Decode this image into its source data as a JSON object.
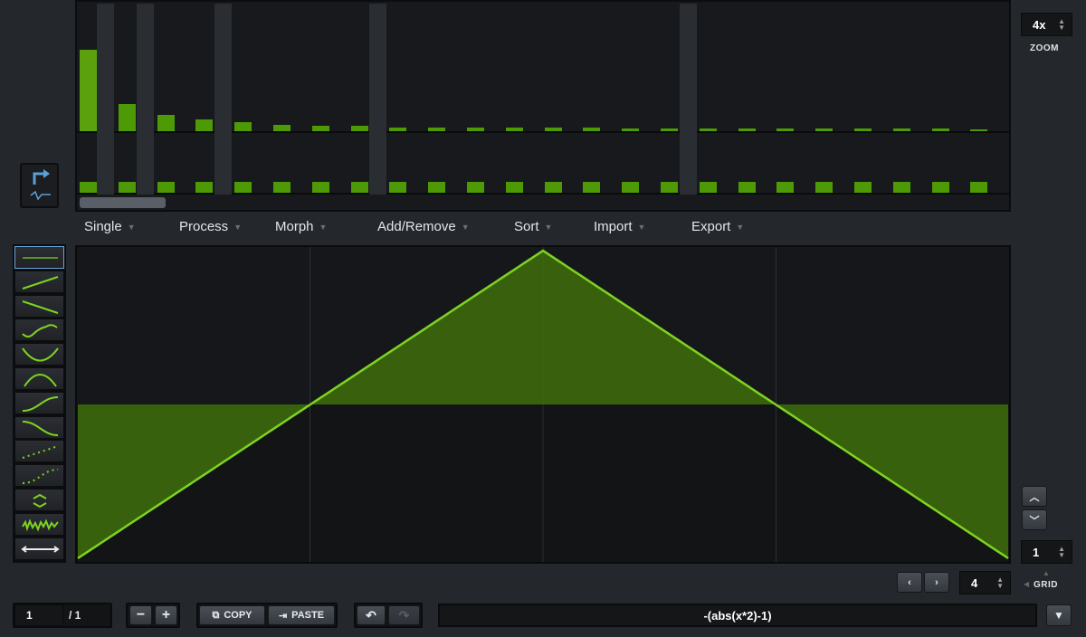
{
  "harmonics": {
    "amplitudes": [
      1.0,
      0.33,
      0.2,
      0.14,
      0.11,
      0.08,
      0.07,
      0.07,
      0.05,
      0.05,
      0.04,
      0.04,
      0.04,
      0.04,
      0.03,
      0.03,
      0.03,
      0.03,
      0.03,
      0.03,
      0.03,
      0.03,
      0.03,
      0.02
    ],
    "phases": [
      1,
      1,
      1,
      1,
      1,
      1,
      1,
      1,
      1,
      1,
      1,
      1,
      1,
      1,
      1,
      1,
      1,
      1,
      1,
      1,
      1,
      1,
      1,
      1
    ],
    "bar_color": "#4e9a06"
  },
  "zoom": {
    "value": "4x",
    "label": "ZOOM"
  },
  "menus": [
    {
      "label": "Single"
    },
    {
      "label": "Process"
    },
    {
      "label": "Morph"
    },
    {
      "label": "Add/Remove"
    },
    {
      "label": "Sort"
    },
    {
      "label": "Import"
    },
    {
      "label": "Export"
    }
  ],
  "shapes": [
    "flat-line",
    "ramp-up",
    "ramp-down",
    "sine",
    "bowl",
    "arch",
    "s-curve-up",
    "s-curve-down",
    "steps-dotted",
    "steps-curved",
    "spread",
    "noise",
    "stretch"
  ],
  "waveform": {
    "formula": "-(abs(x*2)-1)",
    "color": "#7ed321",
    "fill": "#3f6e0c"
  },
  "grid": {
    "value": "4",
    "label": "GRID",
    "vertical": "1"
  },
  "footer": {
    "frame": "1",
    "total": "/ 1",
    "copy": "COPY",
    "paste": "PASTE"
  }
}
